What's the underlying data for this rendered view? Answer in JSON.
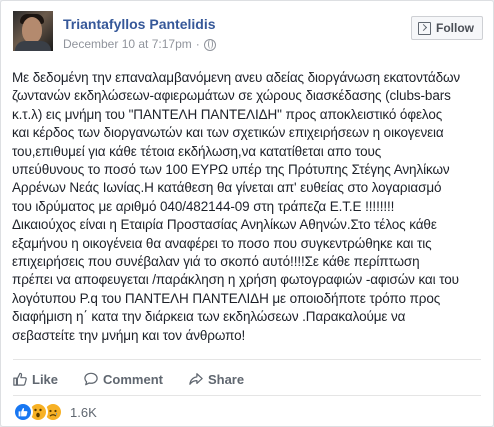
{
  "post": {
    "author": "Triantafyllos Pantelidis",
    "timestamp": "December 10 at 7:17pm",
    "separator": "·",
    "follow_label": "Follow",
    "lines": [
      "Με δεδομένη την επαναλαμβανόμενη ανευ αδείας διοργάνωση εκατοντάδων",
      "ζωντανών εκδηλώσεων-αφιερωμάτων σε χώρους διασκέδασης (clubs-bars",
      "κ.τ.λ) εις μνήμη του \"ΠΑΝΤΕΛΗ ΠΑΝΤΕΛΙΔΗ\" προς αποκλειστικό όφελος",
      "και κέρδος των διοργανωτών και των σχετικών επιχειρήσεων η οικογενεια",
      "του,επιθυμεί για κάθε τέτοια εκδήλωση,να κατατίθεται απο τους",
      "υπεύθυνους το ποσό των 100 ΕΥΡΩ υπέρ της Πρότυπης Στέγης Ανηλίκων",
      "Αρρένων Νεάς Ιωνίας.Η κατάθεση θα γίνεται απ' ευθείας στο λογαριασμό",
      "του ιδρύματος με αριθμό 040/482144-09 στη τράπεζα Ε.Τ.Ε !!!!!!!!",
      "Δικαιούχος είναι η Εταιρία Προστασίας Ανηλίκων Αθηνών.Στο τέλος κάθε",
      "εξαμήνου η οικογένεια θα αναφέρει το ποσο που συγκεντρώθηκε και τις",
      "επιχειρήσεις που συνέβαλαν γιά το σκοπό αυτό!!!!Σε κάθε περίπτωση",
      "πρέπει να αποφευγεται /παράκληση η χρήση φωτογραφιών -αφισών και του",
      "λογότυπου Ρ.q του ΠΑΝΤΕΛΗ ΠΑΝΤΕΛΙΔΗ με οποιοδήποτε τρόπο προς",
      "διαφήμιση η΄ κατα την διάρκεια των εκδηλώσεων .Παρακαλούμε να",
      "σεβαστείτε την μνήμη και τον άνθρωπο!"
    ]
  },
  "actions": {
    "like": "Like",
    "comment": "Comment",
    "share": "Share"
  },
  "reactions": {
    "count": "1.6K",
    "types": [
      "like-icon",
      "wow-icon",
      "sad-icon"
    ]
  },
  "colors": {
    "author_link": "#365899",
    "meta_gray": "#90949c",
    "action_gray": "#606770",
    "like_blue": "#1877f2",
    "emoji_yellow": "#f7b125"
  }
}
